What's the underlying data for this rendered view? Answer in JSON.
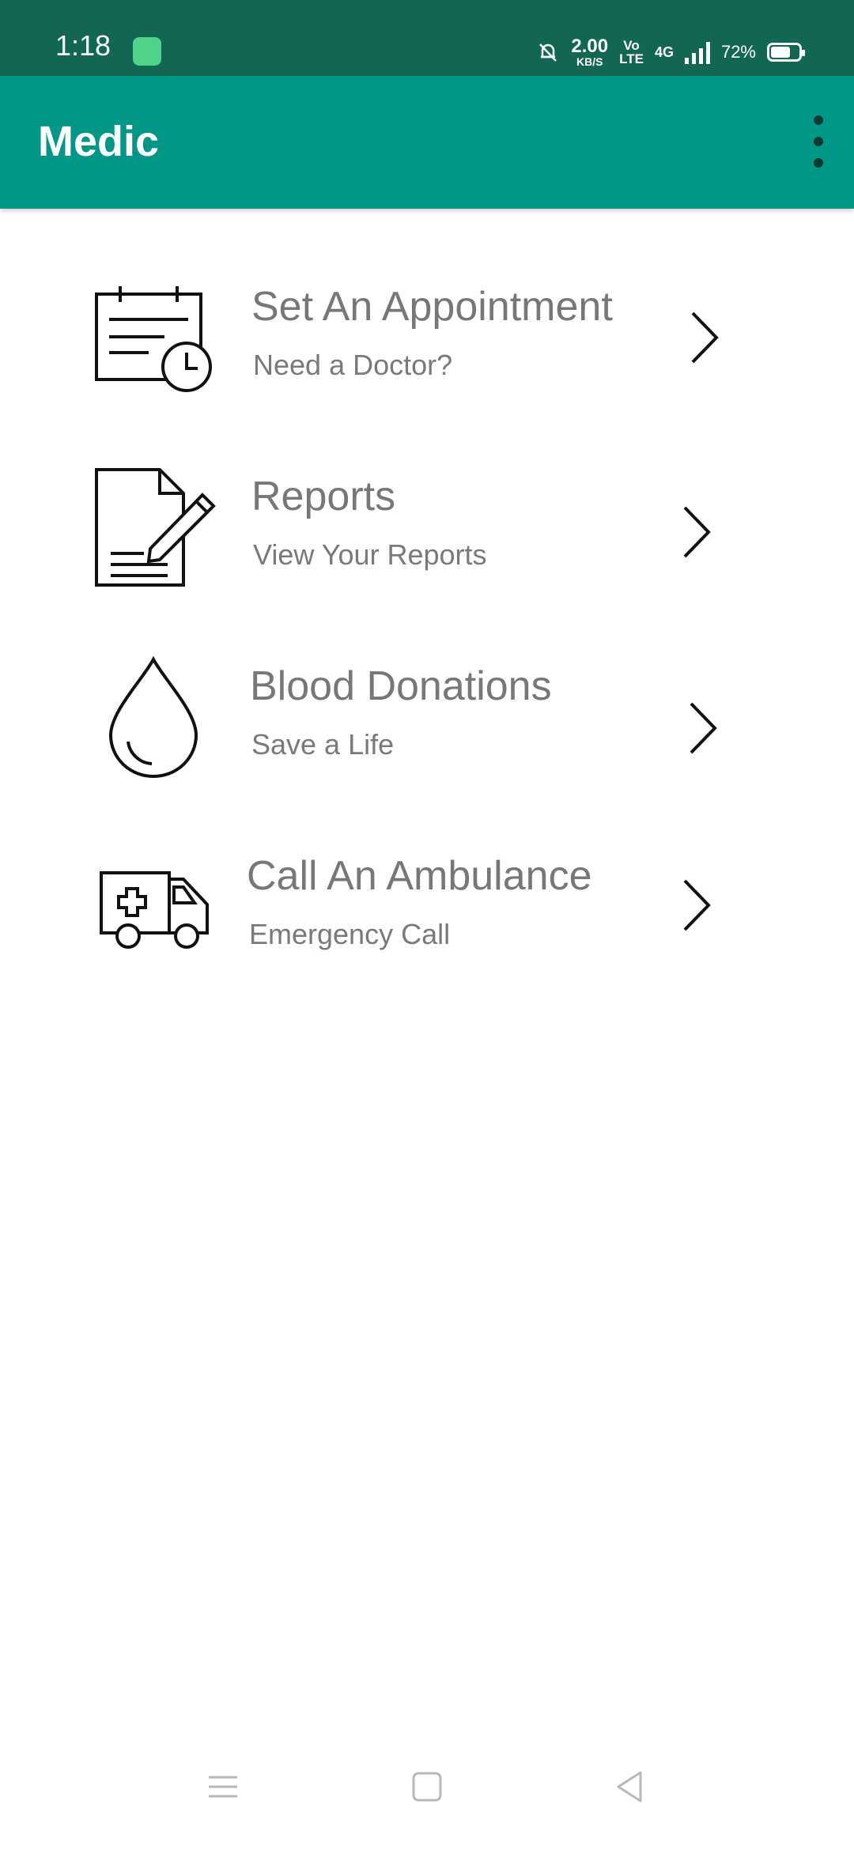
{
  "status_bar": {
    "time": "1:18",
    "net_speed_value": "2.00",
    "net_speed_unit": "KB/S",
    "volte_top": "Vo",
    "volte_bottom": "LTE",
    "network": "4G",
    "battery": "72%",
    "battery_level": 0.72
  },
  "app_bar": {
    "title": "Medic",
    "menu_icon": "overflow-menu-icon"
  },
  "menu": [
    {
      "title": "Set An Appointment",
      "subtitle": "Need a Doctor?",
      "icon": "appointment-calendar-clock-icon"
    },
    {
      "title": "Reports",
      "subtitle": "View Your Reports",
      "icon": "report-document-pen-icon"
    },
    {
      "title": "Blood Donations",
      "subtitle": "Save a Life",
      "icon": "blood-drop-icon"
    },
    {
      "title": "Call An Ambulance",
      "subtitle": "Emergency Call",
      "icon": "ambulance-icon"
    }
  ],
  "nav_bar": {
    "icons": [
      "recents-icon",
      "home-icon",
      "back-icon"
    ]
  },
  "colors": {
    "status_bar": "#126654",
    "app_bar": "#009688",
    "text_gray": "#777777"
  }
}
